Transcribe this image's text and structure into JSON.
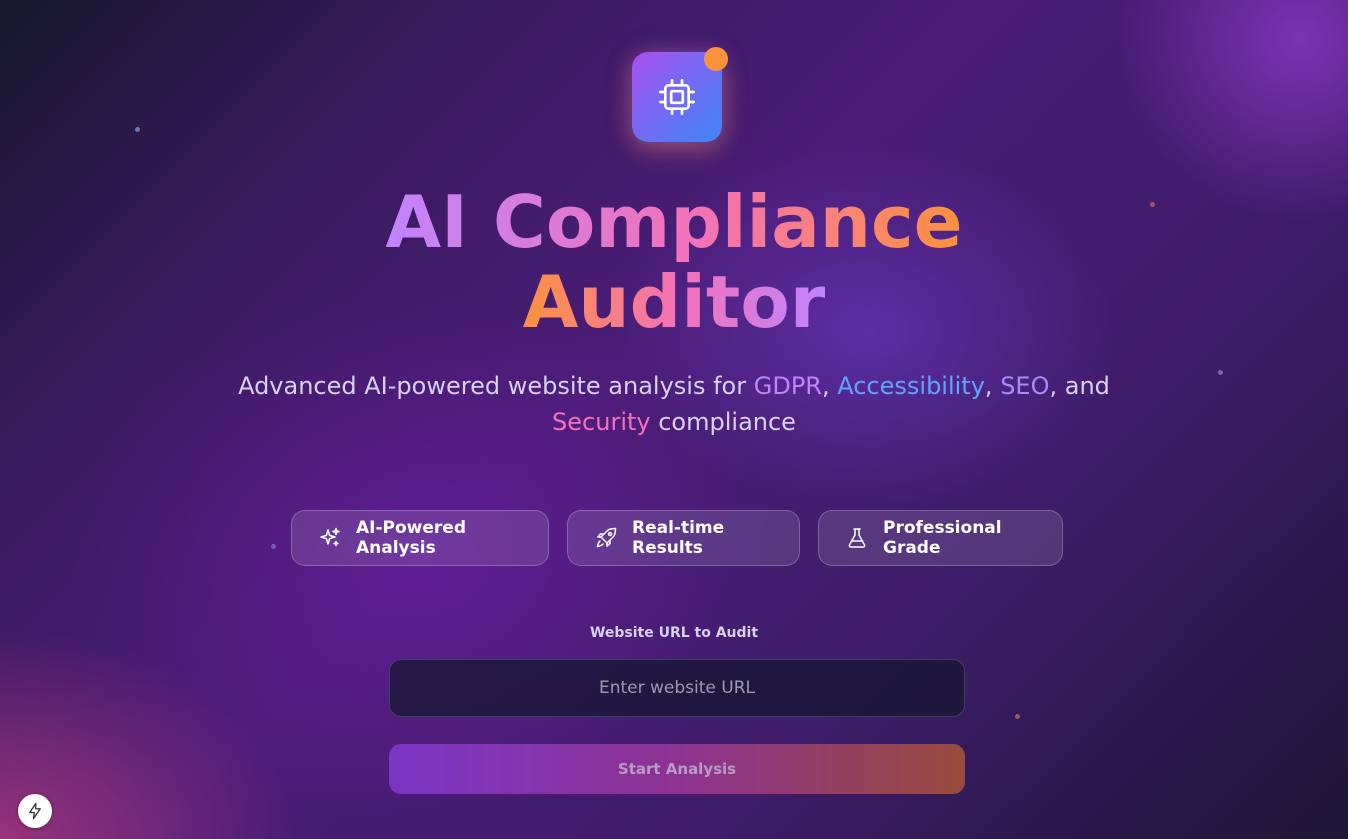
{
  "app": {
    "title_line1": "AI Compliance",
    "title_line2": "Auditor"
  },
  "subtitle": {
    "part1": "Advanced AI-powered website analysis for ",
    "gdpr": "GDPR",
    "sep1": ", ",
    "accessibility": "Accessibility",
    "sep2": ", ",
    "seo": "SEO",
    "part2": ", and ",
    "security": "Security",
    "part3": " compliance"
  },
  "features": [
    {
      "label": "AI-Powered Analysis",
      "icon": "sparkles-icon"
    },
    {
      "label": "Real-time Results",
      "icon": "rocket-icon"
    },
    {
      "label": "Professional Grade",
      "icon": "flask-icon"
    }
  ],
  "form": {
    "url_label": "Website URL to Audit",
    "url_value": "",
    "url_placeholder": "Enter website URL",
    "submit_label": "Start Analysis"
  },
  "icons": {
    "logo": "cpu-chip-icon",
    "corner": "lightning-icon"
  },
  "colors": {
    "accent_purple": "#c084fc",
    "accent_pink": "#f472b6",
    "accent_orange": "#fb923c",
    "accent_blue": "#60a5fa"
  }
}
